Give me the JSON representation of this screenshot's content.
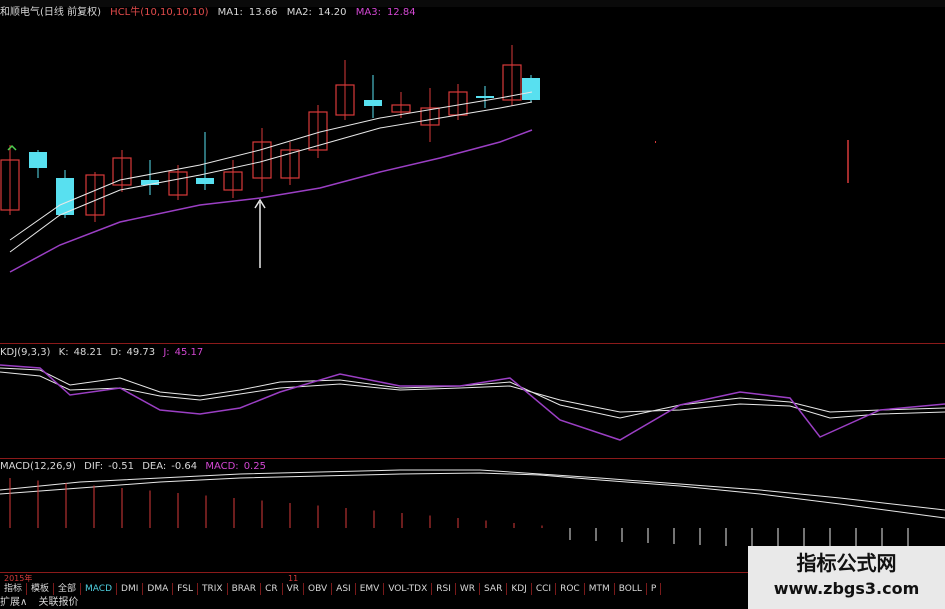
{
  "stock": {
    "name": "和顺电气(日线 前复权)",
    "indicator": "HCL牛(10,10,10,10)",
    "ma1_label": "MA1:",
    "ma1": "13.66",
    "ma2_label": "MA2:",
    "ma2": "14.20",
    "ma3_label": "MA3:",
    "ma3": "12.84"
  },
  "kdj": {
    "name": "KDJ(9,3,3)",
    "k_label": "K:",
    "k": "48.21",
    "d_label": "D:",
    "d": "49.73",
    "j_label": "J:",
    "j": "45.17"
  },
  "macd": {
    "name": "MACD(12,26,9)",
    "dif_label": "DIF:",
    "dif": "-0.51",
    "dea_label": "DEA:",
    "dea": "-0.64",
    "macd_label": "MACD:",
    "macd": "0.25"
  },
  "axis": {
    "year": "2015年",
    "month": "11"
  },
  "tabs": [
    "指标",
    "模板",
    "全部",
    "MACD",
    "DMI",
    "DMA",
    "FSL",
    "TRIX",
    "BRAR",
    "CR",
    "VR",
    "OBV",
    "ASI",
    "EMV",
    "VOL-TDX",
    "RSI",
    "WR",
    "SAR",
    "KDJ",
    "CCI",
    "ROC",
    "MTM",
    "BOLL",
    "P"
  ],
  "active_tab": "MACD",
  "bottom_tabs": [
    "扩展∧",
    "关联报价"
  ],
  "watermark": {
    "title": "指标公式网",
    "url": "www.zbgs3.com"
  },
  "colors": {
    "background": "#000000",
    "up_candle": "#d83a3a",
    "down_candle": "#58e0f0",
    "ma_line": "#e8e8e8",
    "ma3_line": "#9b3fc4",
    "separator": "#8b1a1a",
    "label_magenta": "#d247d2"
  }
}
